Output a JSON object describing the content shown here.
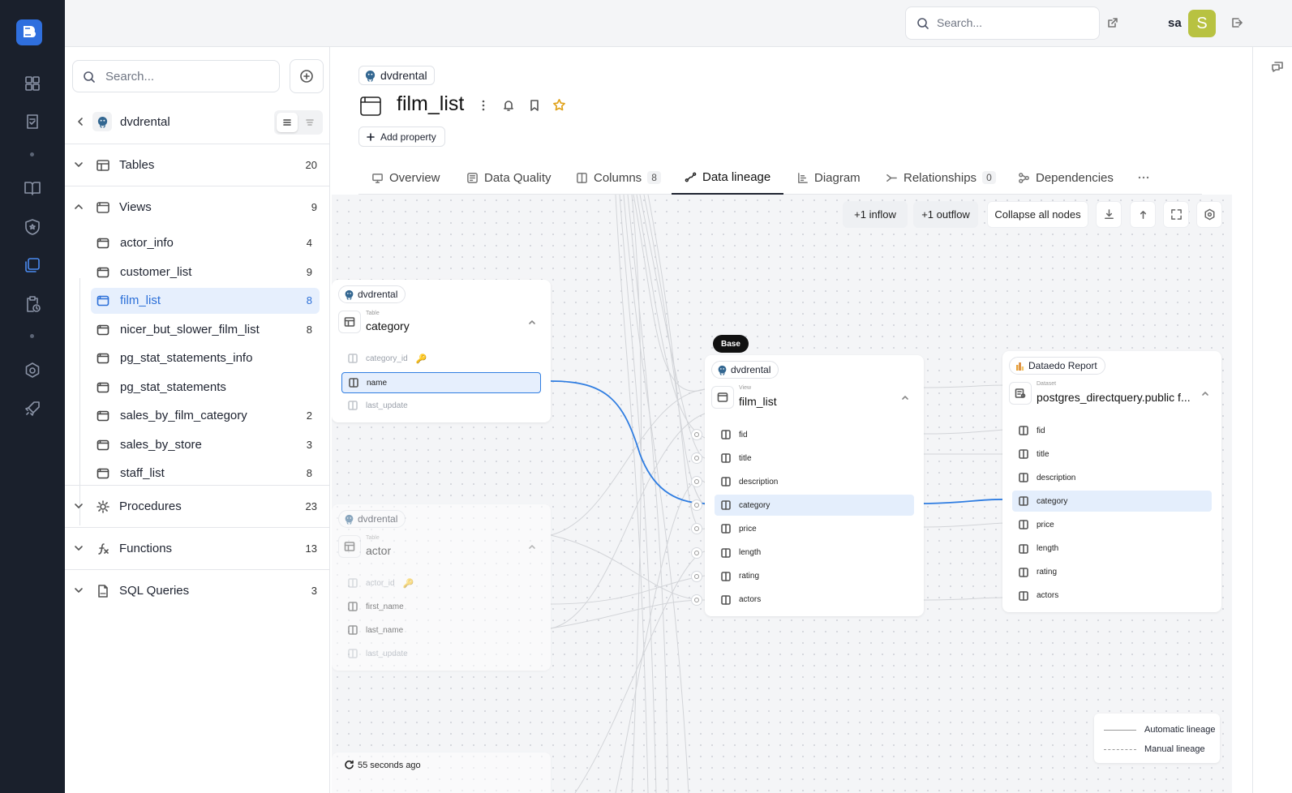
{
  "topbar": {
    "search_placeholder": "Search...",
    "user_name": "sa",
    "avatar_letter": "S",
    "avatar_color": "#b8c241"
  },
  "rail": {
    "items": [
      "logo-icon",
      "dashboard-icon",
      "checklist-icon",
      "book-icon",
      "shield-icon",
      "catalog-icon",
      "clipboard-icon",
      "settings-icon",
      "rocket-icon"
    ],
    "active": "catalog-icon"
  },
  "sidebar": {
    "search_placeholder": "Search...",
    "database_name": "dvdrental",
    "sections": [
      {
        "label": "Tables",
        "count": "20"
      },
      {
        "label": "Views",
        "count": "9"
      },
      {
        "label": "Procedures",
        "count": "23"
      },
      {
        "label": "Functions",
        "count": "13"
      },
      {
        "label": "SQL Queries",
        "count": "3"
      }
    ],
    "views": [
      {
        "label": "actor_info",
        "count": "4"
      },
      {
        "label": "customer_list",
        "count": "9"
      },
      {
        "label": "film_list",
        "count": "8"
      },
      {
        "label": "nicer_but_slower_film_list",
        "count": "8"
      },
      {
        "label": "pg_stat_statements_info",
        "count": ""
      },
      {
        "label": "pg_stat_statements",
        "count": ""
      },
      {
        "label": "sales_by_film_category",
        "count": "2"
      },
      {
        "label": "sales_by_store",
        "count": "3"
      },
      {
        "label": "staff_list",
        "count": "8"
      }
    ],
    "selected_view": "film_list"
  },
  "object": {
    "database_chip": "dvdrental",
    "title": "film_list",
    "add_property": "Add property"
  },
  "tabs": [
    {
      "label": "Overview",
      "badge": ""
    },
    {
      "label": "Data Quality",
      "badge": ""
    },
    {
      "label": "Columns",
      "badge": "8"
    },
    {
      "label": "Data lineage",
      "badge": ""
    },
    {
      "label": "Diagram",
      "badge": ""
    },
    {
      "label": "Relationships",
      "badge": "0"
    },
    {
      "label": "Dependencies",
      "badge": ""
    }
  ],
  "active_tab": "Data lineage",
  "toolbar": {
    "inflow": "+1 inflow",
    "outflow": "+1 outflow",
    "collapse": "Collapse all nodes"
  },
  "nodes": {
    "category": {
      "chip": "dvdrental",
      "type": "Table",
      "name": "category",
      "columns": [
        "category_id",
        "name",
        "last_update"
      ],
      "highlighted": "name"
    },
    "actor": {
      "chip": "dvdrental",
      "type": "Table",
      "name": "actor",
      "columns": [
        "actor_id",
        "first_name",
        "last_name",
        "last_update"
      ]
    },
    "film_list": {
      "badge": "Base",
      "chip": "dvdrental",
      "type": "View",
      "name": "film_list",
      "columns": [
        "fid",
        "title",
        "description",
        "category",
        "price",
        "length",
        "rating",
        "actors"
      ],
      "highlighted": "category"
    },
    "report": {
      "chip": "Dataedo Report",
      "type": "Dataset",
      "name": "postgres_directquery.public f...",
      "columns": [
        "fid",
        "title",
        "description",
        "category",
        "price",
        "length",
        "rating",
        "actors"
      ],
      "highlighted": "category"
    }
  },
  "legend": {
    "automatic": "Automatic lineage",
    "manual": "Manual lineage"
  },
  "status": {
    "saved": "55 seconds ago"
  },
  "colors": {
    "accent": "#2f7de1",
    "rail_bg": "#1a202c",
    "selected_bg": "#e6effd"
  }
}
